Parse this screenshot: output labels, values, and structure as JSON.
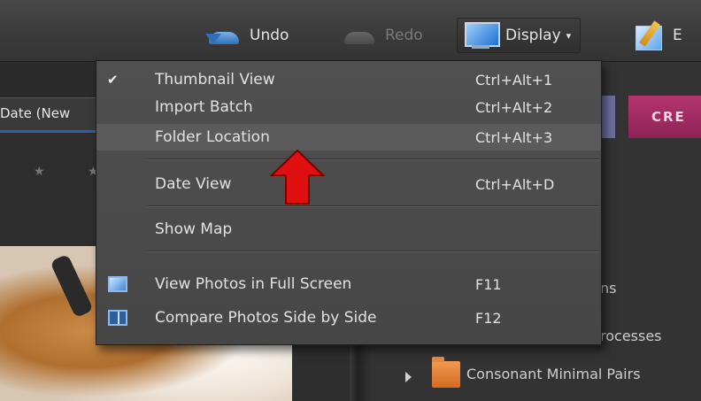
{
  "toolbar": {
    "undo_label": "Undo",
    "redo_label": "Redo",
    "display_label": "Display",
    "display_caret": "▾",
    "edit_label": "E"
  },
  "left_panel": {
    "sort_label": "Date (New",
    "stars": "★ ★"
  },
  "right_panel": {
    "tab_label": "CRE",
    "texts": [
      "ns",
      "rocesses",
      "Consonant Minimal Pairs"
    ]
  },
  "menu": {
    "items": [
      {
        "label": "Thumbnail View",
        "shortcut": "Ctrl+Alt+1",
        "checked": true
      },
      {
        "label": "Import Batch",
        "shortcut": "Ctrl+Alt+2"
      },
      {
        "label": "Folder Location",
        "shortcut": "Ctrl+Alt+3",
        "highlighted": true
      },
      {
        "label": "Date View",
        "shortcut": "Ctrl+Alt+D"
      },
      {
        "label": "Show Map",
        "shortcut": ""
      },
      {
        "label": "View Photos in Full Screen",
        "shortcut": "F11",
        "icon": "fullscreen-icon"
      },
      {
        "label": "Compare Photos Side by Side",
        "shortcut": "F12",
        "icon": "compare-icon"
      }
    ],
    "check_glyph": "✔"
  },
  "colors": {
    "accent_red_arrow": "#e01010",
    "create_tab": "#b5346f",
    "highlight": "#5b5b5b"
  }
}
